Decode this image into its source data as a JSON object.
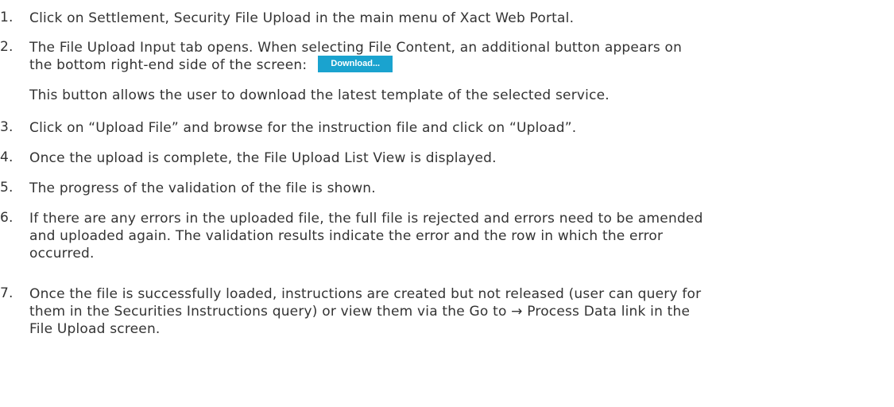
{
  "steps": [
    {
      "num": "1.",
      "lines": [
        "Click on Settlement, Security File Upload in the main menu of Xact Web Portal."
      ]
    },
    {
      "num": "2.",
      "lines": [
        "The File Upload Input tab opens. When selecting File Content, an additional button appears on",
        "the bottom right-end side of the screen:"
      ],
      "button_label": "Download...",
      "extra": "This button allows the user to download the latest template of the selected service."
    },
    {
      "num": "3.",
      "lines": [
        "Click on “Upload File” and browse for the instruction file and click on “Upload”."
      ]
    },
    {
      "num": "4.",
      "lines": [
        "Once the upload is complete, the File Upload List View is displayed."
      ]
    },
    {
      "num": "5.",
      "lines": [
        "The progress of the validation of the file is shown."
      ]
    },
    {
      "num": "6.",
      "lines": [
        "If there are any errors in the uploaded file, the full file is rejected and errors need to be amended",
        "and uploaded again. The validation results indicate the error and the row in which the error",
        "occurred."
      ]
    },
    {
      "num": "7.",
      "lines": [
        "Once the file is successfully loaded, instructions are created but not released (user can query for",
        "them in the Securities Instructions query) or view them via the Go to → Process Data link in the",
        "File Upload screen."
      ]
    }
  ]
}
